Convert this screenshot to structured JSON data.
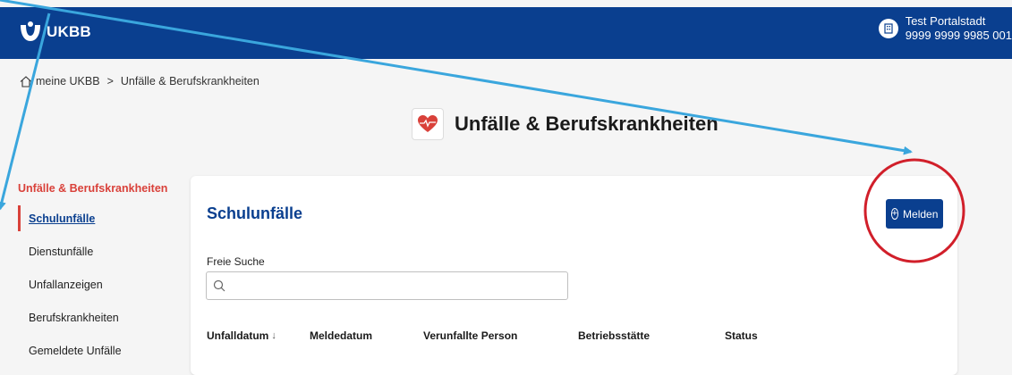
{
  "header": {
    "logo_text": "UKBB",
    "user_name": "Test Portalstadt",
    "user_id": "9999 9999 9985 001"
  },
  "breadcrumb": {
    "home": "meine UKBB",
    "separator": ">",
    "current": "Unfälle & Berufskrankheiten"
  },
  "page": {
    "title": "Unfälle & Berufskrankheiten"
  },
  "sidebar": {
    "heading": "Unfälle & Berufskrankheiten",
    "items": [
      {
        "label": "Schulunfälle",
        "active": true
      },
      {
        "label": "Dienstunfälle"
      },
      {
        "label": "Unfallanzeigen"
      },
      {
        "label": "Berufskrankheiten"
      },
      {
        "label": "Gemeldete Unfälle"
      }
    ]
  },
  "main": {
    "title": "Schulunfälle",
    "melden_label": "Melden",
    "search": {
      "label": "Freie Suche",
      "placeholder": "",
      "value": ""
    },
    "columns": [
      "Unfalldatum",
      "Meldedatum",
      "Verunfallte Person",
      "Betriebsstätte",
      "Status"
    ],
    "sort_indicator": "↓"
  },
  "colors": {
    "brand_blue": "#0a3f8f",
    "accent_red": "#d9413a",
    "annotation_arrow": "#3aa6dd",
    "annotation_circle": "#d11f2a"
  }
}
